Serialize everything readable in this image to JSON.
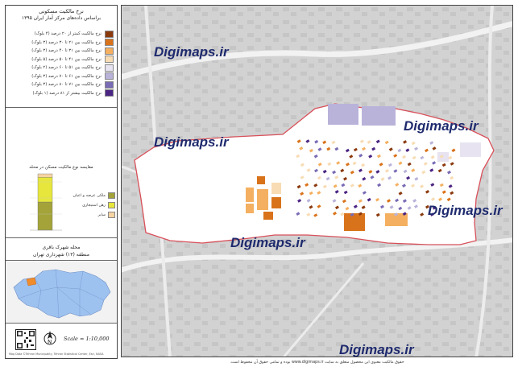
{
  "legend": {
    "title": "نرخ مالکیت مسکونی",
    "subtitle": "براساس داده‌های مرکز آمار ایران ۱۳۹۵",
    "items": [
      {
        "label": "نرخ مالکیت کمتر از ۲۰ درصد (۴ بلوک)",
        "color": "#8b3a0e"
      },
      {
        "label": "نرخ مالکیت بین ۲۱ تا ۳۰ درصد (۳ بلوک)",
        "color": "#d9731b"
      },
      {
        "label": "نرخ مالکیت بین ۳۱ تا ۴۰ درصد (۳ بلوک)",
        "color": "#f4b060"
      },
      {
        "label": "نرخ مالکیت بین ۴۱ تا ۵۰ درصد (۵ بلوک)",
        "color": "#f8dcb4"
      },
      {
        "label": "نرخ مالکیت بین ۵۱ تا ۶۰ درصد (۲ بلوک)",
        "color": "#e7e3f0"
      },
      {
        "label": "نرخ مالکیت بین ۶۱ تا ۷۰ درصد (۳ بلوک)",
        "color": "#b9b3da"
      },
      {
        "label": "نرخ مالکیت بین ۷۱ تا ۸۰ درصد (۳ بلوک)",
        "color": "#7a6bb5"
      },
      {
        "label": "نرخ مالکیت بیشتر از ۸۱ درصد (۱ بلوک)",
        "color": "#4b2583"
      }
    ]
  },
  "chart": {
    "title": "مقایسه نوع مالکیت مسکن در محله",
    "items": [
      {
        "label": "ملکی عرصه و اعیان",
        "color": "#a3a33a"
      },
      {
        "label": "رهن استیجاری",
        "color": "#e6e63c"
      },
      {
        "label": "سایر",
        "color": "#f6d3a2"
      }
    ]
  },
  "chart_data": {
    "type": "bar",
    "categories": [
      ""
    ],
    "series": [
      {
        "name": "ملکی عرصه و اعیان",
        "values": [
          50
        ]
      },
      {
        "name": "رهن استیجاری",
        "values": [
          44
        ]
      },
      {
        "name": "سایر",
        "values": [
          6
        ]
      }
    ],
    "stacked": true,
    "ylim": [
      0,
      100
    ]
  },
  "location": {
    "neighborhood": "محله شهرک باقری",
    "district": "منطقه (۱۳) شهرداری تهران"
  },
  "scale": "Scale = 1:10,000",
  "watermark": "Digimaps.ir",
  "credit": "Map Data ©Tehran Municipality, Tehran Statistical Center, Esri, NASA",
  "footer": "حقوق مالکیت معنوی این محصول متعلق به سایت www.digimaps.ir بوده و تمامی حقوق آن محفوظ است.",
  "colors": {
    "boundary": "#d8505a",
    "district": "#9ec2f0",
    "highlight": "#f08c2c"
  }
}
